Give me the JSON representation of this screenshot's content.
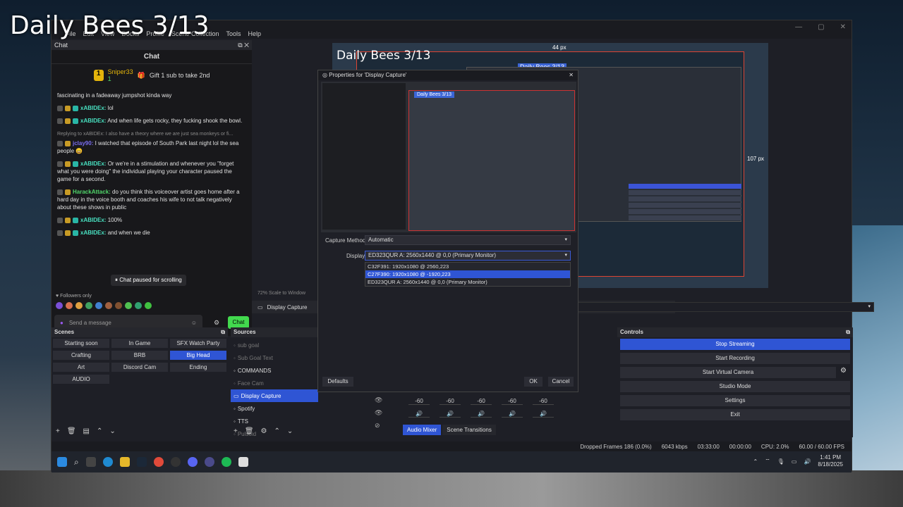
{
  "overlay_title": "Daily Bees 3/13",
  "menu": [
    "File",
    "Edit",
    "View",
    "Docks",
    "Profile",
    "Scene Collection",
    "Tools",
    "Help"
  ],
  "chat": {
    "dock_label": "Chat",
    "title": "Chat",
    "pinned": {
      "rank": "1",
      "user": "Sniper33",
      "count": "1",
      "text": "Gift 1 sub to take 2nd"
    },
    "messages": [
      {
        "name": "",
        "text": "fascinating in a fadeaway jumpshot kinda way",
        "color": ""
      },
      {
        "name": "xABIDEx:",
        "text": "lol",
        "color": "teal"
      },
      {
        "name": "xABIDEx:",
        "text": "And when life gets rocky, they fucking shook the bowl.",
        "color": "teal"
      },
      {
        "reply": "Replying to xABIDEx: I also have a theory where we are just sea monkeys or fi..."
      },
      {
        "name": "jclay90:",
        "text": "I watched that episode of South Park last night lol the sea people 😄",
        "color": "p"
      },
      {
        "name": "xABIDEx:",
        "text": "Or we're in a stimulation and whenever you \"forget what you were doing\" the individual playing your character paused the game for a second.",
        "color": "teal"
      },
      {
        "name": "HarackAttack:",
        "text": "do you think this voiceover artist goes home after a hard day in the voice booth and coaches his wife to not talk negatively about these shows in public",
        "color": "g"
      },
      {
        "name": "xABIDEx:",
        "text": "100%",
        "color": "teal"
      },
      {
        "name": "xABIDEx:",
        "text": "and when we die",
        "color": "teal"
      }
    ],
    "paused_text": "Chat paused for scrolling",
    "followers_only": "Followers only",
    "input_placeholder": "Send a message",
    "send_label": "Chat"
  },
  "preview": {
    "title": "Daily Bees 3/13",
    "label_top": "44 px",
    "label_right": "107 px",
    "nested_title": "Daily Bees 3/13",
    "scale_text": "72%   Scale to Window"
  },
  "source_bar": {
    "icon": "gear-icon",
    "label": "Display Capture"
  },
  "dialog": {
    "title": "Properties for 'Display Capture'",
    "preview_tag": "Daily Bees 3/13",
    "capture_method_label": "Capture Method",
    "capture_method_value": "Automatic",
    "display_label": "Display",
    "display_value": "ED323QUR A: 2560x1440 @ 0,0 (Primary Monitor)",
    "display_options": [
      "C32F391: 1920x1080 @ 2560,223",
      "C27F390: 1920x1080 @ -1920,223",
      "ED323QUR A: 2560x1440 @ 0,0 (Primary Monitor)"
    ],
    "selected_index": 1,
    "defaults": "Defaults",
    "ok": "OK",
    "cancel": "Cancel"
  },
  "scenes": {
    "title": "Scenes",
    "items": [
      "Starting soon",
      "In Game",
      "SFX Watch Party",
      "Crafting",
      "BRB",
      "Big Head",
      "Art",
      "Discord Cam",
      "Ending",
      "AUDIO"
    ],
    "active": "Big Head"
  },
  "sources": {
    "title": "Sources",
    "items": [
      {
        "label": "sub goal",
        "state": "dim"
      },
      {
        "label": "Sub Goal Text",
        "state": "dim"
      },
      {
        "label": "COMMANDS",
        "state": ""
      },
      {
        "label": "Face Cam",
        "state": "dim"
      },
      {
        "label": "Display Capture",
        "state": "active"
      },
      {
        "label": "Spotify",
        "state": ""
      },
      {
        "label": "TTS",
        "state": ""
      },
      {
        "label": "Pulsoid",
        "state": "dim"
      }
    ]
  },
  "mixer": {
    "tabs": [
      "Audio Mixer",
      "Scene Transitions"
    ],
    "level": "-60"
  },
  "controls": {
    "title": "Controls",
    "buttons": [
      "Stop Streaming",
      "Start Recording",
      "Start Virtual Camera",
      "Studio Mode",
      "Settings",
      "Exit"
    ]
  },
  "status": {
    "dropped": "Dropped Frames 186 (0.0%)",
    "kbps": "6043 kbps",
    "stream_time": "03:33:00",
    "rec_time": "00:00:00",
    "cpu": "CPU: 2.0%",
    "fps": "60.00 / 60.00 FPS"
  },
  "taskbar": {
    "time": "1:41 PM",
    "date": "8/18/2025"
  },
  "colors": {
    "accent": "#2f55d4",
    "chat_green": "#42d94e",
    "bits_gold": "#e4b40b"
  }
}
